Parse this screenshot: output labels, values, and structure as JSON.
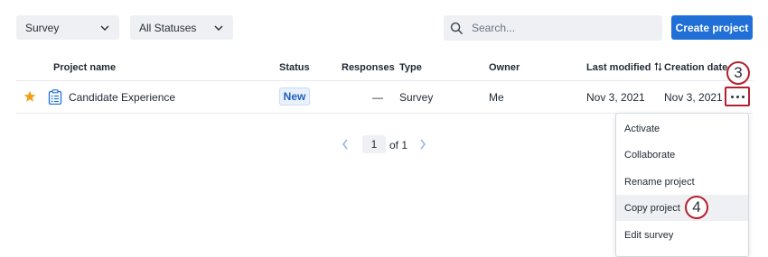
{
  "filters": {
    "type_select": "Survey",
    "status_select": "All Statuses"
  },
  "search": {
    "placeholder": "Search..."
  },
  "toolbar": {
    "create_label": "Create project"
  },
  "table": {
    "columns": {
      "project_name": "Project name",
      "status": "Status",
      "responses": "Responses",
      "type": "Type",
      "owner": "Owner",
      "last_modified": "Last modified",
      "creation_date": "Creation date"
    },
    "rows": [
      {
        "name": "Candidate Experience",
        "status": "New",
        "responses": "—",
        "type": "Survey",
        "owner": "Me",
        "last_modified": "Nov 3, 2021",
        "creation_date": "Nov 3, 2021",
        "favorite": true
      }
    ]
  },
  "pagination": {
    "page": "1",
    "of_label": "of 1"
  },
  "menu": {
    "items": [
      "Activate",
      "Collaborate",
      "Rename project",
      "Copy project",
      "Edit survey"
    ],
    "highlighted": "Copy project"
  },
  "annotations": {
    "step_a": "3",
    "step_b": "4"
  },
  "colors": {
    "primary": "#1f6fd6",
    "annotation": "#b5202e",
    "star": "#f0a11a",
    "badge_text": "#1f5fbf"
  },
  "icons": [
    "chevron-down-icon",
    "search-icon",
    "sort-icon",
    "star-icon",
    "survey-icon",
    "more-icon",
    "chevron-left-icon",
    "chevron-right-icon"
  ]
}
